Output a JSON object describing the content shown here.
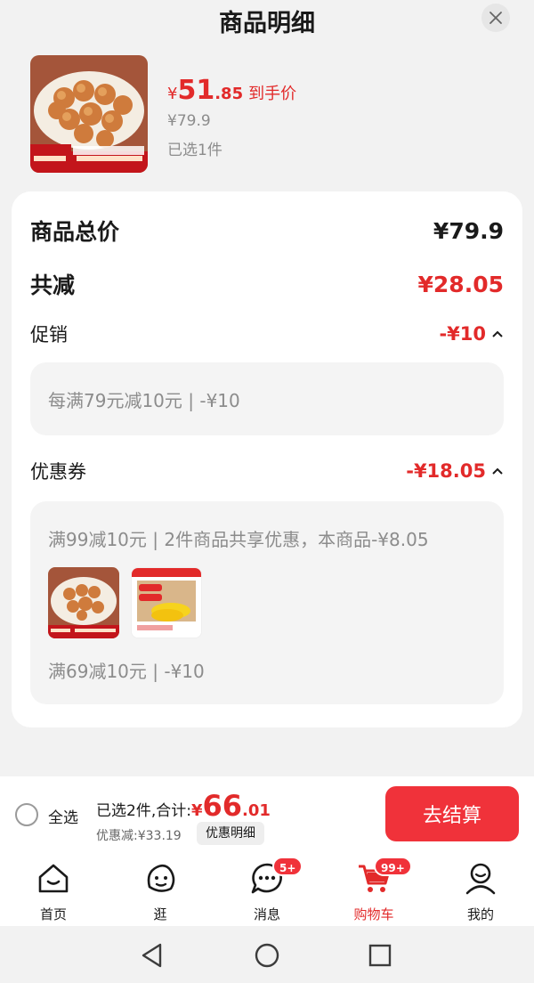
{
  "header": {
    "title": "商品明细"
  },
  "product": {
    "price_symbol": "¥",
    "price_int": "51",
    "price_dec": ".85",
    "price_label": "到手价",
    "original_price": "¥79.9",
    "selected": "已选1件",
    "image_icon": "meatball-product-image"
  },
  "breakdown": {
    "total_label": "商品总价",
    "total_value": "¥79.9",
    "reduce_label": "共减",
    "reduce_value": "¥28.05",
    "promo_label": "促销",
    "promo_value": "-¥10",
    "promo_detail": "每满79元减10元 | -¥10",
    "coupon_label": "优惠券",
    "coupon_value": "-¥18.05",
    "coupon_detail1": "满99减10元 | 2件商品共享优惠，本商品-¥8.05",
    "coupon_detail2": "满69减10元 | -¥10",
    "coupon_item_icons": [
      "meatball-product-image",
      "corn-product-image"
    ]
  },
  "bottom_bar": {
    "select_all": "全选",
    "summary_label": "已选2件,合计:",
    "total_symbol": "¥",
    "total_int": "66",
    "total_dec": ".01",
    "discount": "优惠减:¥33.19",
    "detail_button": "优惠明细",
    "checkout_button": "去结算"
  },
  "tabs": [
    {
      "label": "首页",
      "icon": "home-icon"
    },
    {
      "label": "逛",
      "icon": "explore-face-icon"
    },
    {
      "label": "消息",
      "icon": "message-icon",
      "badge": "5+"
    },
    {
      "label": "购物车",
      "icon": "cart-icon",
      "badge": "99+",
      "active": true
    },
    {
      "label": "我的",
      "icon": "profile-icon"
    }
  ],
  "colors": {
    "accent": "#e22a2a",
    "checkout": "#f0323a",
    "background": "#f2f2f2"
  }
}
